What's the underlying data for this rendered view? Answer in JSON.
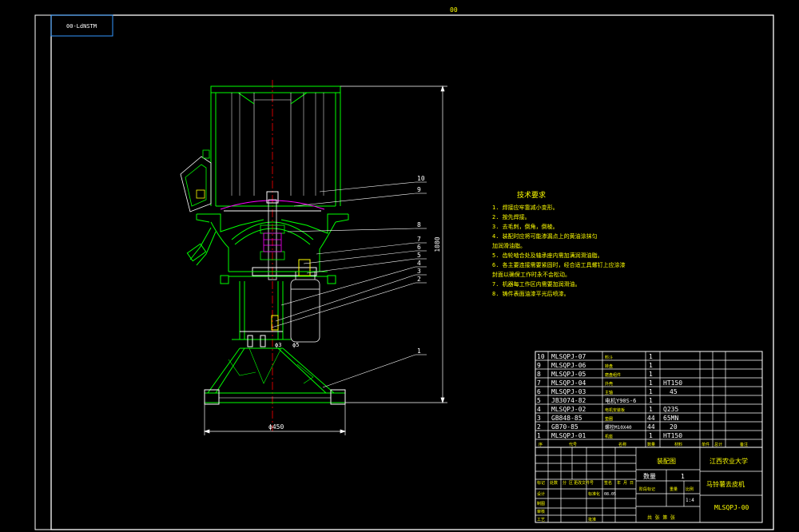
{
  "frame": {
    "top_mark": "00",
    "stamp": "00-LdNSTM"
  },
  "dimensions": {
    "height": "1080",
    "base_diameter": "ϕ450",
    "small_left": "ϕ3",
    "small_right": "ϕ5"
  },
  "leaders": [
    "10",
    "9",
    "8",
    "7",
    "6",
    "5",
    "4",
    "3",
    "2",
    "1"
  ],
  "tech_notes": {
    "title": "技术要求",
    "lines": [
      "1. 焊接应牢靠减小变形。",
      "2. 按先焊接。",
      "3. 去毛刺，倒角，倒棱。",
      "4. 装配时应将可能渗漏点上的黄油涂抹匀",
      "加润滑油脂。",
      "5. 齿轮啮合处及轴承座内需加满润滑油脂。",
      "6. 各主要连接需要紧固时，经合适工具螺钉上应涂漆",
      "封面以确保工作时永不会松动。",
      "7. 机器每工作区内需要加润滑油。",
      "8. 铸件表面油漆平光后喷漆。"
    ]
  },
  "bom": {
    "rows": [
      {
        "no": "10",
        "code": "MLSQPJ-07",
        "name": "料斗",
        "qty": "1",
        "material": "",
        "note": ""
      },
      {
        "no": "9",
        "code": "MLSQPJ-06",
        "name": "转盘",
        "qty": "1",
        "material": "",
        "note": ""
      },
      {
        "no": "8",
        "code": "MLSQPJ-05",
        "name": "磨盘组件",
        "qty": "1",
        "material": "",
        "note": ""
      },
      {
        "no": "7",
        "code": "MLSQPJ-04",
        "name": "外壳",
        "qty": "1",
        "material": "HT150",
        "note": ""
      },
      {
        "no": "6",
        "code": "MLSQPJ-03",
        "name": "主轴",
        "qty": "1",
        "material": "45",
        "note": ""
      },
      {
        "no": "5",
        "code": "JB3074-82",
        "name": "电机Y90S-6",
        "qty": "1",
        "material": "",
        "note": ""
      },
      {
        "no": "4",
        "code": "MLSQPJ-02",
        "name": "电机安装板",
        "qty": "1",
        "material": "Q235",
        "note": ""
      },
      {
        "no": "3",
        "code": "GB848-85",
        "name": "垫圈",
        "qty": "44",
        "material": "65MN",
        "note": ""
      },
      {
        "no": "2",
        "code": "GB70-85",
        "name": "螺栓M10X40",
        "qty": "44",
        "material": "20",
        "note": ""
      },
      {
        "no": "1",
        "code": "MLSQPJ-01",
        "name": "机座",
        "qty": "1",
        "material": "HT150",
        "note": ""
      }
    ],
    "header": {
      "no": "序",
      "code": "代号",
      "name": "名称",
      "qty": "数量",
      "material": "材料",
      "unit_wt": "单件",
      "total_wt": "总计",
      "note": "备注"
    }
  },
  "title_block": {
    "drawing_title": "装配图",
    "school": "江西农业大学",
    "qty_label": "数量",
    "qty_value": "1",
    "machine_name": "马铃薯去皮机",
    "drawing_no": "MLSQPJ-00",
    "scale_label": "比例",
    "scale_value": "1:4",
    "weight_label": "重量",
    "stage_label": "阶段标记",
    "sheet_label": "共 张 第 张",
    "rev_cols": [
      "标记",
      "处数",
      "分 区",
      "更改文件号",
      "签名",
      "年 月 日"
    ],
    "roles": [
      "设计",
      "制图",
      "审核",
      "工艺"
    ],
    "std_label": "标准化",
    "approve_label": "批准",
    "date_short": "08.05"
  }
}
